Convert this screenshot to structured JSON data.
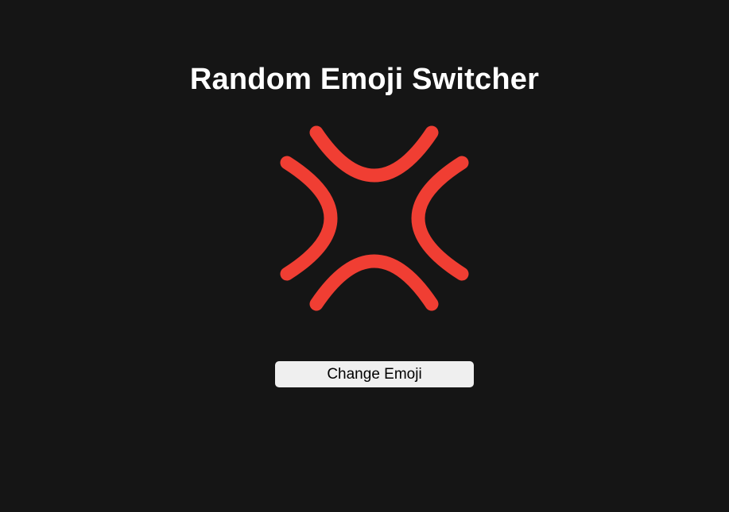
{
  "page": {
    "title": "Random Emoji Switcher"
  },
  "emoji": {
    "icon": "anger-symbol-icon",
    "color": "#f03e33"
  },
  "button": {
    "label": "Change Emoji"
  },
  "colors": {
    "background": "#151515",
    "title_text": "#ffffff",
    "button_bg": "#efefef",
    "button_text": "#000000"
  }
}
